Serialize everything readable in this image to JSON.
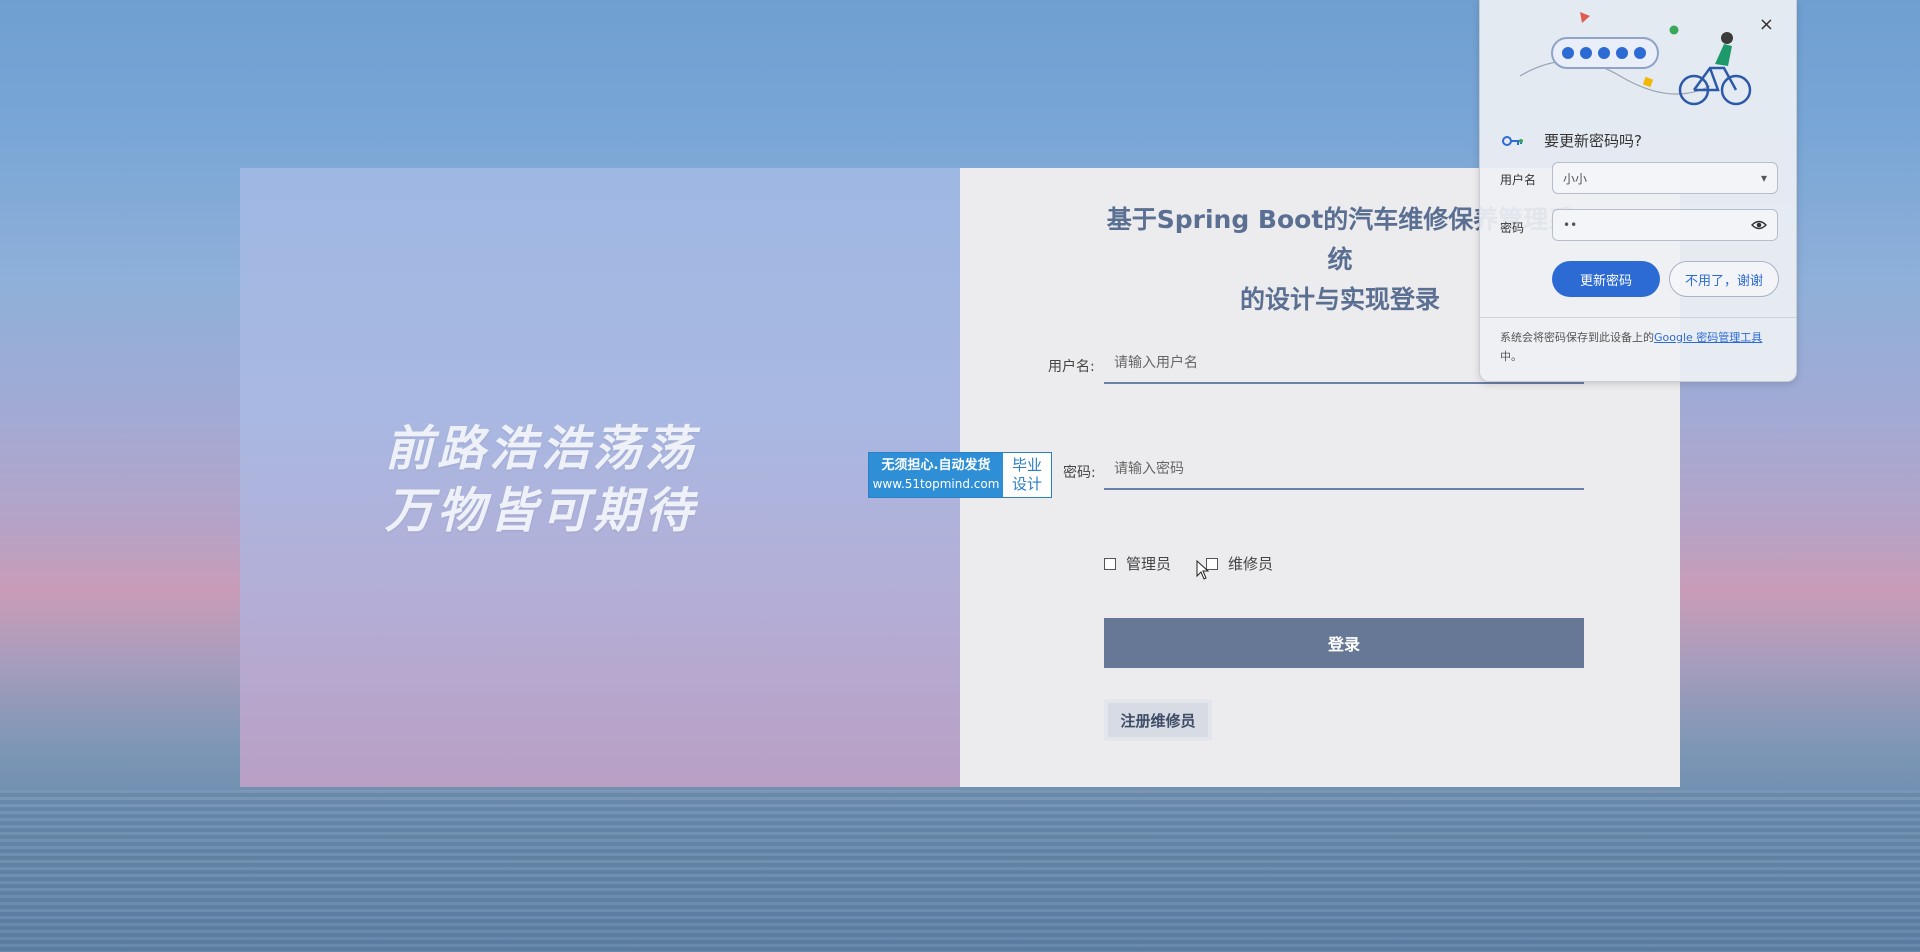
{
  "slogan": {
    "line1": "前路浩浩荡荡",
    "line2": "万物皆可期待"
  },
  "login": {
    "title_line1": "基于Spring Boot的汽车维修保养管理系统",
    "title_line2": "的设计与实现登录",
    "username_label": "用户名:",
    "username_placeholder": "请输入用户名",
    "password_label": "密码:",
    "password_placeholder": "请输入密码",
    "role_admin": "管理员",
    "role_repairman": "维修员",
    "login_button": "登录",
    "register_button": "注册维修员"
  },
  "badge": {
    "line1": "无须担心.自动发货",
    "url": "www.51topmind.com",
    "right_line1": "毕业",
    "right_line2": "设计"
  },
  "password_popup": {
    "close": "×",
    "heading": "要更新密码吗?",
    "username_label": "用户名",
    "username_value": "小小",
    "password_label": "密码",
    "password_value": "••",
    "update_button": "更新密码",
    "no_thanks_button": "不用了，谢谢",
    "footer_text": "系统会将密码保存到此设备上的",
    "footer_link": "Google 密码管理工具",
    "footer_suffix": "中。"
  }
}
